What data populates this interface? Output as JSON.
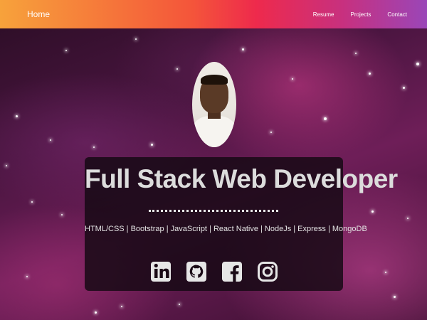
{
  "nav": {
    "brand": "Home",
    "links": [
      "Resume",
      "Projects",
      "Contact"
    ]
  },
  "hero": {
    "title": "Full Stack Web Developer",
    "skills": "HTML/CSS | Bootstrap | JavaScript | React Native | NodeJs | Express | MongoDB"
  },
  "socials": [
    "linkedin-icon",
    "github-icon",
    "facebook-icon",
    "instagram-icon"
  ],
  "colors": {
    "nav_gradient": [
      "#f7a23b",
      "#f4553a",
      "#ee2a4c",
      "#c8307e",
      "#9a46b8"
    ],
    "text": "#dcdcdc",
    "icon": "#e6e6e6"
  }
}
